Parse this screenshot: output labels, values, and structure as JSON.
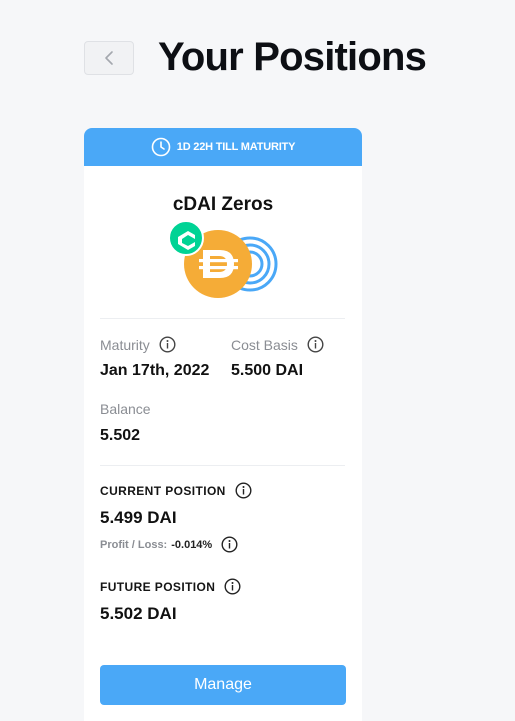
{
  "header": {
    "title": "Your Positions"
  },
  "card": {
    "banner_text": "1D 22H TILL MATURITY",
    "token_name": "cDAI Zeros",
    "maturity": {
      "label": "Maturity",
      "value": "Jan 17th, 2022"
    },
    "cost_basis": {
      "label": "Cost Basis",
      "value": "5.500 DAI"
    },
    "balance": {
      "label": "Balance",
      "value": "5.502"
    },
    "current_position": {
      "label": "CURRENT POSITION",
      "value": "5.499 DAI",
      "profit_loss_label": "Profit / Loss:",
      "profit_loss_value": "-0.014%"
    },
    "future_position": {
      "label": "FUTURE POSITION",
      "value": "5.502 DAI"
    },
    "manage_label": "Manage"
  },
  "colors": {
    "accent": "#4aa8f7",
    "background": "#f6f7f9",
    "dai": "#f5ac37",
    "compound": "#00d395"
  },
  "icons": [
    "chevron-left-icon",
    "clock-icon",
    "compound-icon",
    "dai-icon",
    "info-icon"
  ]
}
